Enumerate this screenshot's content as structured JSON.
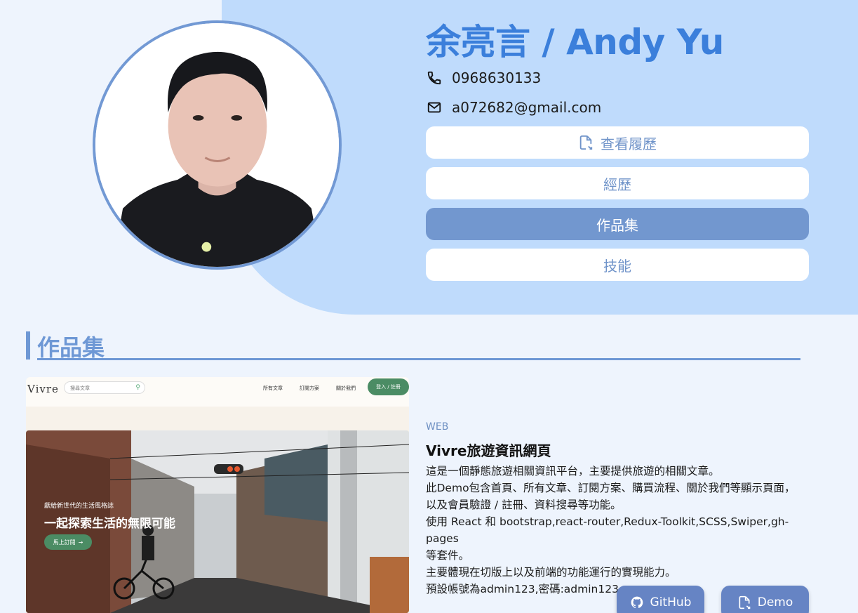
{
  "profile": {
    "name": "余亮言 / Andy Yu",
    "phone": "0968630133",
    "email": "a072682@gmail.com"
  },
  "nav": {
    "resume_label": "查看履歷",
    "experience_label": "經歷",
    "portfolio_label": "作品集",
    "skills_label": "技能",
    "active": "portfolio"
  },
  "section": {
    "title": "作品集"
  },
  "work": {
    "category": "WEB",
    "title": "Vivre旅遊資訊網頁",
    "description": [
      "這是一個靜態旅遊相關資訊平台，主要提供旅遊的相關文章。",
      "此Demo包含首頁、所有文章、訂閱方案、購買流程、關於我們等顯示頁面，",
      "以及會員驗證 / 註冊、資料搜尋等功能。",
      "使用 React 和 bootstrap,react-router,Redux-Toolkit,SCSS,Swiper,gh-pages",
      "等套件。",
      "主要體現在切版上以及前端的功能運行的實現能力。",
      "預設帳號為admin123,密碼:admin123"
    ],
    "github_label": "GitHub",
    "demo_label": "Demo",
    "screenshot": {
      "logo": "Vivre",
      "search_placeholder": "搜尋文章",
      "nav_links": [
        "所有文章",
        "訂閱方案",
        "關於我們"
      ],
      "login_label": "登入 / 註冊",
      "hero_subtitle": "獻給新世代的生活風格誌",
      "hero_title": "一起探索生活的無限可能",
      "cta_label": "馬上訂閱"
    }
  },
  "colors": {
    "hero_bg": "#bfdbfc",
    "page_bg": "#eef4fd",
    "accent": "#3b7fdb",
    "button_active": "#7297cf",
    "link_button": "#6684c4"
  },
  "icons": {
    "phone": "phone-icon",
    "email": "mail-icon",
    "resume": "file-user-icon",
    "github": "github-icon",
    "demo": "file-icon"
  }
}
